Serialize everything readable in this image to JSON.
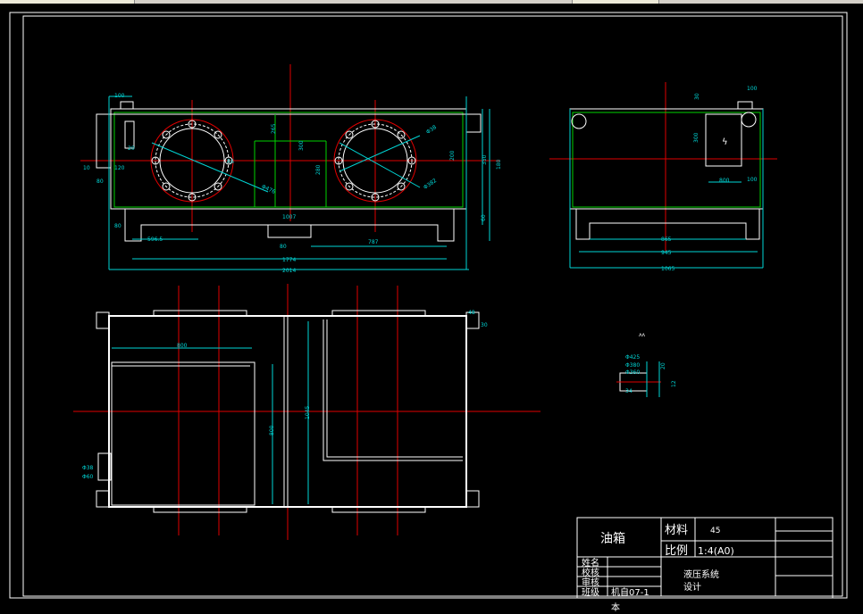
{
  "title_block": {
    "part_name": "油箱",
    "material_label": "材料",
    "material_value": "45",
    "scale_label": "比例",
    "scale_value": "1:4(A0)",
    "design_title_1": "液压系统",
    "design_title_2": "设计",
    "rows": [
      "姓名",
      "校核",
      "审核",
      "班级"
    ],
    "class_value": "机自07-1",
    "class_value_cont": "本"
  },
  "dimensions": {
    "front": [
      "100",
      "2014",
      "1774",
      "1007",
      "787",
      "80",
      "596.5",
      "80",
      "120",
      "10",
      "80",
      "20",
      "300",
      "280",
      "265",
      "200",
      "350",
      "180",
      "60",
      "Φ476",
      "Φ382",
      "R6",
      "Φ38"
    ],
    "side": [
      "100",
      "30",
      "1065",
      "865",
      "945",
      "300",
      "80",
      "800",
      "100",
      "30"
    ],
    "plan": [
      "800",
      "1045",
      "800",
      "48",
      "30",
      "Φ38",
      "Φ60"
    ],
    "detail": [
      "Φ425",
      "Φ380",
      "Φ360",
      "20",
      "34",
      "12"
    ]
  },
  "colors": {
    "background": "#000000",
    "outline": "#ffffff",
    "hidden": "#00d200",
    "dimension": "#00d6d6",
    "centerline": "#e00000"
  }
}
